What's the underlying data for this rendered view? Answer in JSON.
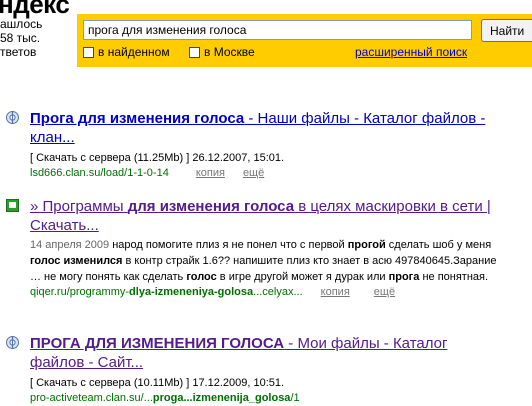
{
  "header": {
    "logo_text": "ндекс",
    "found_line1": "ашлось",
    "found_line2": "58 тыс.",
    "found_line3": "тветов"
  },
  "search": {
    "query": "прога для изменения голоса",
    "button_label": "Найти",
    "option_found": "в найденном",
    "option_moscow": "в Москве",
    "advanced_link": "расширенный поиск"
  },
  "results": [
    {
      "title_bold": "Прога для изменения голоса",
      "title_rest": " - Наши файлы - Каталог файлов - клан...",
      "snippet": "[ Скачать с сервера (11.25Mb) ] 26.12.2007, 15:01.",
      "url": "lsd666.clan.su/load/1-1-0-14",
      "copy": "копия",
      "more": "ещё"
    },
    {
      "title_pre": "» Программы ",
      "title_bold": "для изменения голоса",
      "title_rest": " в целях маскировки в сети | Скачать...",
      "date": "14 апреля 2009",
      "s1": " народ помогите плиз я не понел что с первой ",
      "s1b": "прогой",
      "s2": " сделать шоб у меня ",
      "s2b": "голос изменился",
      "s3": " в контр страйк 1.6?? напишите плиз кто знает в асю 497840645.Зарание … не могу понять как сделать ",
      "s3b": "голос",
      "s4": " в игре другой может я дурак или ",
      "s4b": "прога",
      "s5": " не понятная.",
      "url_pre": "qiqer.ru/programmy-",
      "url_bold": "dlya-izmeneniya-golosa",
      "url_post": "...celyax...",
      "copy": "копия",
      "more": "ещё"
    },
    {
      "title_bold": "ПРОГА ДЛЯ ИЗМЕНЕНИЯ ГОЛОСА",
      "title_rest": " - Мои файлы - Каталог файлов - Сайт...",
      "snippet": "[ Скачать с сервера (10.11Mb) ] 17.12.2009, 10:51.",
      "url_pre": "pro-activeteam.clan.su/...",
      "url_bold": "proga...izmenenija_golosa",
      "url_post": "/1"
    }
  ]
}
